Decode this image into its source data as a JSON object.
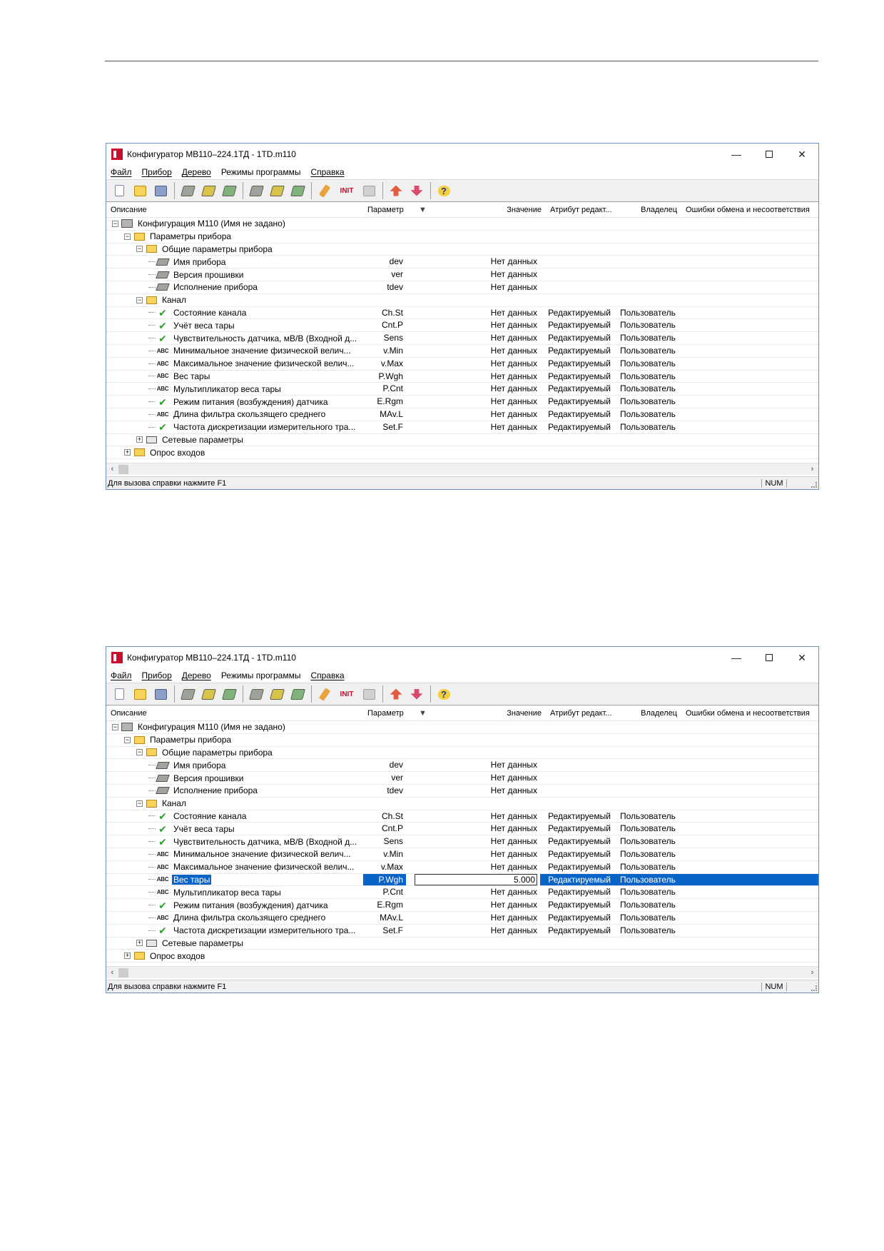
{
  "screens": [
    {
      "title": "Конфигуратор МВ110–224.1ТД - 1TD.m110",
      "menu": [
        "Файл",
        "Прибор",
        "Дерево",
        "Режимы программы",
        "Справка"
      ],
      "toolbar": {
        "init_label": "INIT"
      },
      "columns": {
        "desc": "Описание",
        "param": "Параметр",
        "value": "Значение",
        "attr": "Атрибут редакт...",
        "owner": "Владелец",
        "errors": "Ошибки обмена и несоответствия"
      },
      "rows": [
        {
          "level": 0,
          "exp": "−",
          "icon": "root",
          "desc": "Конфигурация М110 (Имя не задано)",
          "param": "",
          "value": "",
          "attr": "",
          "owner": ""
        },
        {
          "level": 1,
          "exp": "−",
          "icon": "folder",
          "desc": "Параметры прибора",
          "param": "",
          "value": "",
          "attr": "",
          "owner": ""
        },
        {
          "level": 2,
          "exp": "−",
          "icon": "folder",
          "desc": "Общие параметры прибора",
          "param": "",
          "value": "",
          "attr": "",
          "owner": ""
        },
        {
          "level": 3,
          "exp": "",
          "icon": "device",
          "desc": "Имя прибора",
          "param": "dev",
          "value": "Нет данных",
          "attr": "",
          "owner": ""
        },
        {
          "level": 3,
          "exp": "",
          "icon": "device",
          "desc": "Версия прошивки",
          "param": "ver",
          "value": "Нет данных",
          "attr": "",
          "owner": ""
        },
        {
          "level": 3,
          "exp": "",
          "icon": "device",
          "desc": "Исполнение прибора",
          "param": "tdev",
          "value": "Нет данных",
          "attr": "",
          "owner": ""
        },
        {
          "level": 2,
          "exp": "−",
          "icon": "folder",
          "desc": "Канал",
          "param": "",
          "value": "",
          "attr": "",
          "owner": ""
        },
        {
          "level": 3,
          "exp": "",
          "icon": "check",
          "desc": "Состояние канала",
          "param": "Ch.St",
          "value": "Нет данных",
          "attr": "Редактируемый",
          "owner": "Пользователь"
        },
        {
          "level": 3,
          "exp": "",
          "icon": "check",
          "desc": "Учёт веса тары",
          "param": "Cnt.P",
          "value": "Нет данных",
          "attr": "Редактируемый",
          "owner": "Пользователь"
        },
        {
          "level": 3,
          "exp": "",
          "icon": "check",
          "desc": "Чувствительность датчика, мВ/В (Входной д...",
          "param": "Sens",
          "value": "Нет данных",
          "attr": "Редактируемый",
          "owner": "Пользователь"
        },
        {
          "level": 3,
          "exp": "",
          "icon": "abc",
          "desc": "Минимальное значение физической велич...",
          "param": "v.Min",
          "value": "Нет данных",
          "attr": "Редактируемый",
          "owner": "Пользователь"
        },
        {
          "level": 3,
          "exp": "",
          "icon": "abc",
          "desc": "Максимальное значение физической велич...",
          "param": "v.Max",
          "value": "Нет данных",
          "attr": "Редактируемый",
          "owner": "Пользователь"
        },
        {
          "level": 3,
          "exp": "",
          "icon": "abc",
          "desc": "Вес тары",
          "param": "P.Wgh",
          "value": "Нет данных",
          "attr": "Редактируемый",
          "owner": "Пользователь"
        },
        {
          "level": 3,
          "exp": "",
          "icon": "abc",
          "desc": "Мультипликатор веса тары",
          "param": "P.Cnt",
          "value": "Нет данных",
          "attr": "Редактируемый",
          "owner": "Пользователь"
        },
        {
          "level": 3,
          "exp": "",
          "icon": "check",
          "desc": "Режим питания (возбуждения) датчика",
          "param": "E.Rgm",
          "value": "Нет данных",
          "attr": "Редактируемый",
          "owner": "Пользователь"
        },
        {
          "level": 3,
          "exp": "",
          "icon": "abc",
          "desc": "Длина фильтра скользящего среднего",
          "param": "MAv.L",
          "value": "Нет данных",
          "attr": "Редактируемый",
          "owner": "Пользователь"
        },
        {
          "level": 3,
          "exp": "",
          "icon": "check",
          "desc": "Частота дискретизации измерительного тра...",
          "param": "Set.F",
          "value": "Нет данных",
          "attr": "Редактируемый",
          "owner": "Пользователь"
        },
        {
          "level": 2,
          "exp": "+",
          "icon": "net",
          "desc": "Сетевые параметры",
          "param": "",
          "value": "",
          "attr": "",
          "owner": ""
        },
        {
          "level": 1,
          "exp": "+",
          "icon": "folder",
          "desc": "Опрос входов",
          "param": "",
          "value": "",
          "attr": "",
          "owner": ""
        }
      ],
      "status": {
        "text": "Для вызова справки нажмите F1",
        "num": "NUM"
      }
    },
    {
      "title": "Конфигуратор МВ110–224.1ТД - 1TD.m110",
      "menu": [
        "Файл",
        "Прибор",
        "Дерево",
        "Режимы программы",
        "Справка"
      ],
      "toolbar": {
        "init_label": "INIT"
      },
      "columns": {
        "desc": "Описание",
        "param": "Параметр",
        "value": "Значение",
        "attr": "Атрибут редакт...",
        "owner": "Владелец",
        "errors": "Ошибки обмена и несоответствия"
      },
      "rows": [
        {
          "level": 0,
          "exp": "−",
          "icon": "root",
          "desc": "Конфигурация М110 (Имя не задано)",
          "param": "",
          "value": "",
          "attr": "",
          "owner": ""
        },
        {
          "level": 1,
          "exp": "−",
          "icon": "folder",
          "desc": "Параметры прибора",
          "param": "",
          "value": "",
          "attr": "",
          "owner": ""
        },
        {
          "level": 2,
          "exp": "−",
          "icon": "folder",
          "desc": "Общие параметры прибора",
          "param": "",
          "value": "",
          "attr": "",
          "owner": ""
        },
        {
          "level": 3,
          "exp": "",
          "icon": "device",
          "desc": "Имя прибора",
          "param": "dev",
          "value": "Нет данных",
          "attr": "",
          "owner": ""
        },
        {
          "level": 3,
          "exp": "",
          "icon": "device",
          "desc": "Версия прошивки",
          "param": "ver",
          "value": "Нет данных",
          "attr": "",
          "owner": ""
        },
        {
          "level": 3,
          "exp": "",
          "icon": "device",
          "desc": "Исполнение прибора",
          "param": "tdev",
          "value": "Нет данных",
          "attr": "",
          "owner": ""
        },
        {
          "level": 2,
          "exp": "−",
          "icon": "folder",
          "desc": "Канал",
          "param": "",
          "value": "",
          "attr": "",
          "owner": ""
        },
        {
          "level": 3,
          "exp": "",
          "icon": "check",
          "desc": "Состояние канала",
          "param": "Ch.St",
          "value": "Нет данных",
          "attr": "Редактируемый",
          "owner": "Пользователь"
        },
        {
          "level": 3,
          "exp": "",
          "icon": "check",
          "desc": "Учёт веса тары",
          "param": "Cnt.P",
          "value": "Нет данных",
          "attr": "Редактируемый",
          "owner": "Пользователь"
        },
        {
          "level": 3,
          "exp": "",
          "icon": "check",
          "desc": "Чувствительность датчика, мВ/В (Входной д...",
          "param": "Sens",
          "value": "Нет данных",
          "attr": "Редактируемый",
          "owner": "Пользователь"
        },
        {
          "level": 3,
          "exp": "",
          "icon": "abc",
          "desc": "Минимальное значение физической велич...",
          "param": "v.Min",
          "value": "Нет данных",
          "attr": "Редактируемый",
          "owner": "Пользователь"
        },
        {
          "level": 3,
          "exp": "",
          "icon": "abc",
          "desc": "Максимальное значение физической велич...",
          "param": "v.Max",
          "value": "Нет данных",
          "attr": "Редактируемый",
          "owner": "Пользователь"
        },
        {
          "level": 3,
          "exp": "",
          "icon": "abc",
          "desc": "Вес тары",
          "param": "P.Wgh",
          "value": "5.000",
          "attr": "Редактируемый",
          "owner": "Пользователь",
          "selected": true
        },
        {
          "level": 3,
          "exp": "",
          "icon": "abc",
          "desc": "Мультипликатор веса тары",
          "param": "P.Cnt",
          "value": "Нет данных",
          "attr": "Редактируемый",
          "owner": "Пользователь"
        },
        {
          "level": 3,
          "exp": "",
          "icon": "check",
          "desc": "Режим питания (возбуждения) датчика",
          "param": "E.Rgm",
          "value": "Нет данных",
          "attr": "Редактируемый",
          "owner": "Пользователь"
        },
        {
          "level": 3,
          "exp": "",
          "icon": "abc",
          "desc": "Длина фильтра скользящего среднего",
          "param": "MAv.L",
          "value": "Нет данных",
          "attr": "Редактируемый",
          "owner": "Пользователь"
        },
        {
          "level": 3,
          "exp": "",
          "icon": "check",
          "desc": "Частота дискретизации измерительного тра...",
          "param": "Set.F",
          "value": "Нет данных",
          "attr": "Редактируемый",
          "owner": "Пользователь"
        },
        {
          "level": 2,
          "exp": "+",
          "icon": "net",
          "desc": "Сетевые параметры",
          "param": "",
          "value": "",
          "attr": "",
          "owner": ""
        },
        {
          "level": 1,
          "exp": "+",
          "icon": "folder",
          "desc": "Опрос входов",
          "param": "",
          "value": "",
          "attr": "",
          "owner": ""
        }
      ],
      "status": {
        "text": "Для вызова справки нажмите F1",
        "num": "NUM"
      }
    }
  ],
  "icon_text": {
    "abc": "ABC",
    "check": "✔",
    "help": "?"
  }
}
